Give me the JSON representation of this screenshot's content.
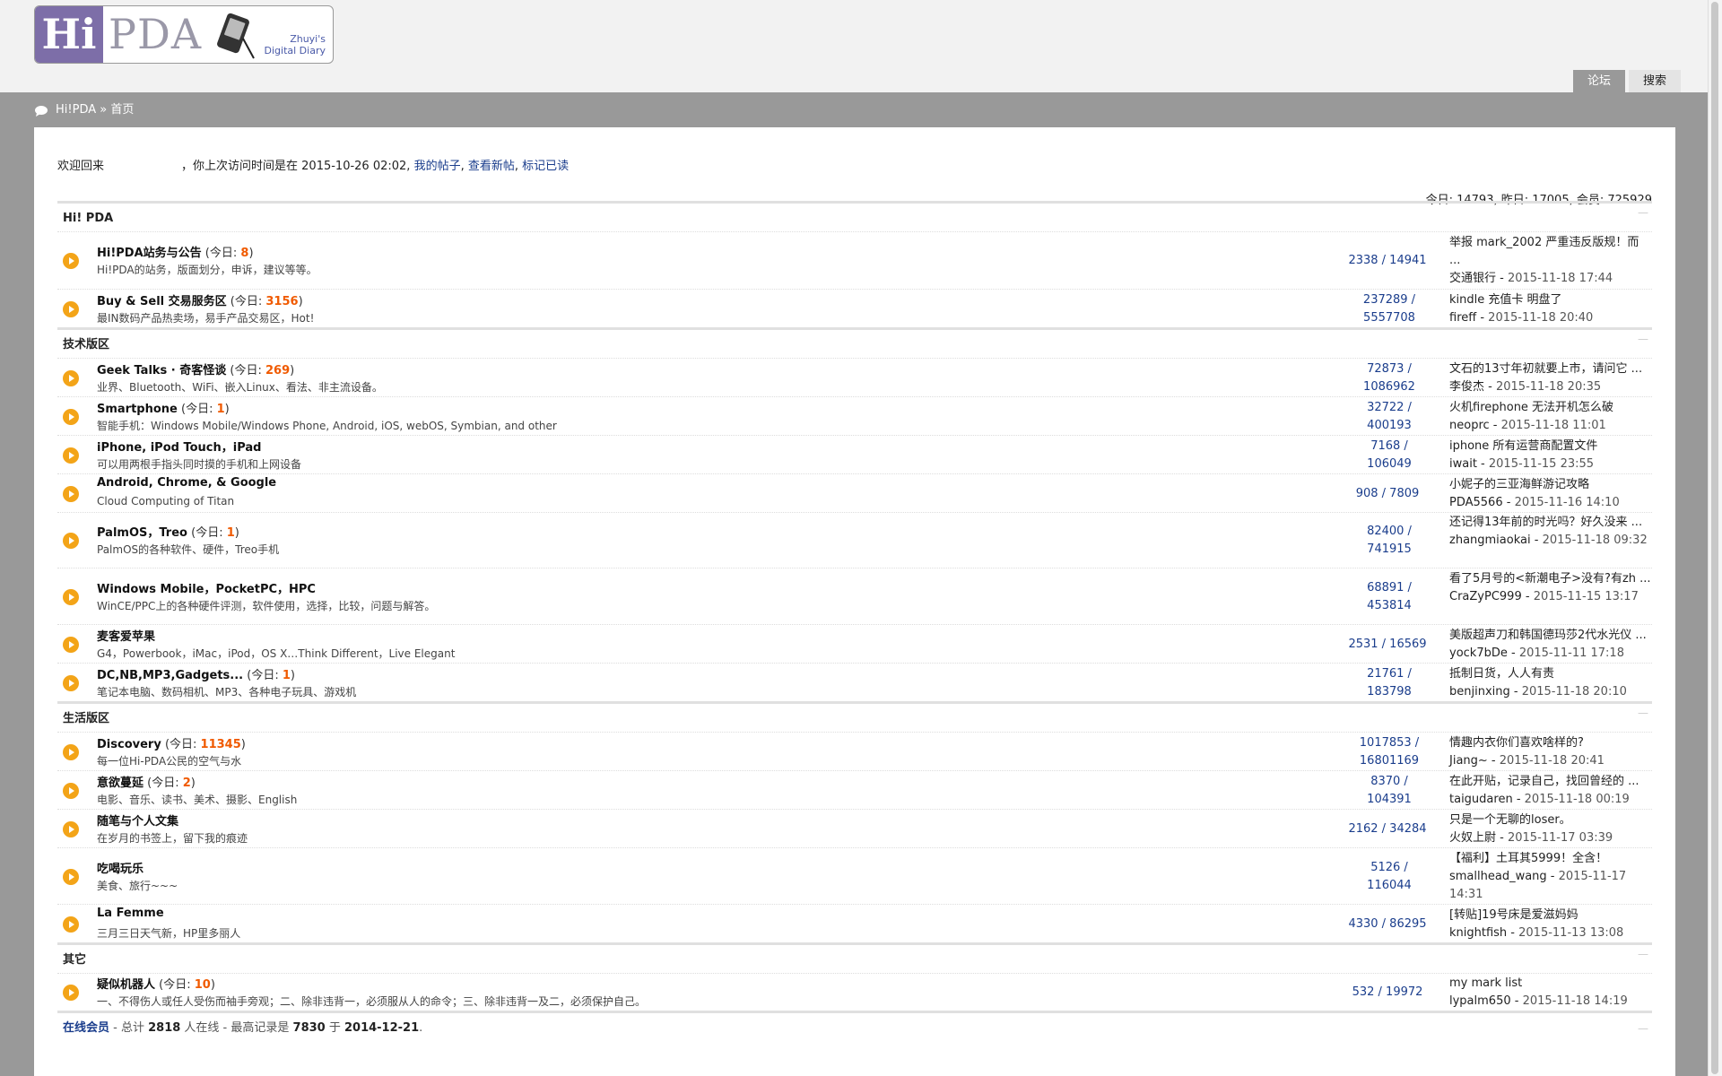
{
  "logo": {
    "hi": "Hi",
    "pda": "PDA",
    "tag_line1": "Zhuyi's",
    "tag_line2": "Digital Diary"
  },
  "nav": {
    "forum": "论坛",
    "search": "搜索"
  },
  "breadcrumb": {
    "site": "Hi!PDA",
    "sep": "»",
    "page": "首页"
  },
  "welcome": {
    "prefix": "欢迎回来",
    "last_visit": "，你上次访问时间是在 2015-10-26 02:02,",
    "my_posts": "我的帖子",
    "new_posts": "查看新帖",
    "mark_read": "标记已读",
    "comma": ","
  },
  "stats": "今日: 14793, 昨日: 17005, 会员: 725929",
  "today_label": "今日: ",
  "categories": [
    {
      "name": "Hi! PDA",
      "forums": [
        {
          "name": "Hi!PDA站务与公告",
          "today": "8",
          "desc": "Hi!PDA的站务，版面划分，申诉，建议等等。",
          "count": "2338 / 14941",
          "last_title": "举报 mark_2002 严重违反版规！而 ...",
          "last_user": "交通银行",
          "last_time": "2015-11-18 17:44"
        },
        {
          "name": "Buy & Sell 交易服务区",
          "today": "3156",
          "desc": "最IN数码产品热卖场，易手产品交易区，Hot!",
          "count": "237289 / 5557708",
          "last_title": "kindle 充值卡 明盘了",
          "last_user": "fireff",
          "last_time": "2015-11-18 20:40"
        }
      ]
    },
    {
      "name": "技术版区",
      "forums": [
        {
          "name": "Geek Talks · 奇客怪谈",
          "today": "269",
          "desc": "业界、Bluetooth、WiFi、嵌入Linux、看法、非主流设备。",
          "count": "72873 / 1086962",
          "last_title": "文石的13寸年初就要上市，请问它 ...",
          "last_user": "李俊杰",
          "last_time": "2015-11-18 20:35"
        },
        {
          "name": "Smartphone",
          "today": "1",
          "desc": "智能手机：Windows Mobile/Windows Phone, Android, iOS, webOS, Symbian, and other",
          "count": "32722 / 400193",
          "last_title": "火机firephone 无法开机怎么破",
          "last_user": "neoprc",
          "last_time": "2015-11-18 11:01"
        },
        {
          "name": "iPhone, iPod Touch，iPad",
          "today": "",
          "desc": "可以用两根手指头同时摸的手机和上网设备",
          "count": "7168 / 106049",
          "last_title": "iphone 所有运营商配置文件",
          "last_user": "iwait",
          "last_time": "2015-11-15 23:55"
        },
        {
          "name": "Android, Chrome, & Google",
          "today": "",
          "desc": "Cloud Computing of Titan",
          "count": "908 / 7809",
          "last_title": "小妮子的三亚海鲜游记攻略",
          "last_user": "PDA5566",
          "last_time": "2015-11-16 14:10"
        },
        {
          "name": "PalmOS，Treo",
          "today": "1",
          "desc": "PalmOS的各种软件、硬件，Treo手机",
          "count": "82400 / 741915",
          "last_title": "还记得13年前的时光吗？好久没来 ...",
          "last_user": "zhangmiaokai",
          "last_time": "2015-11-18 09:32"
        },
        {
          "name": "Windows Mobile，PocketPC，HPC",
          "today": "",
          "desc": "WinCE/PPC上的各种硬件评测，软件使用，选择，比较，问题与解答。",
          "count": "68891 / 453814",
          "last_title": "看了5月号的<新潮电子>没有?有zh ...",
          "last_user": "CraZyPC999",
          "last_time": "2015-11-15 13:17"
        },
        {
          "name": "麦客爱苹果",
          "today": "",
          "desc": "G4，Powerbook，iMac，iPod，OS X…Think Different，Live Elegant",
          "count": "2531 / 16569",
          "last_title": "美版超声刀和韩国德玛莎2代水光仪 ...",
          "last_user": "yock7bDe",
          "last_time": "2015-11-11 17:18"
        },
        {
          "name": "DC,NB,MP3,Gadgets...",
          "today": "1",
          "desc": "笔记本电脑、数码相机、MP3、各种电子玩具、游戏机",
          "count": "21761 / 183798",
          "last_title": "抵制日货，人人有责",
          "last_user": "benjinxing",
          "last_time": "2015-11-18 20:10"
        }
      ]
    },
    {
      "name": "生活版区",
      "forums": [
        {
          "name": "Discovery",
          "today": "11345",
          "desc": "每一位Hi-PDA公民的空气与水",
          "count": "1017853 / 16801169",
          "last_title": "情趣内衣你们喜欢啥样的?",
          "last_user": "Jiang~",
          "last_time": "2015-11-18 20:41"
        },
        {
          "name": "意欲蔓延",
          "today": "2",
          "desc": "电影、音乐、读书、美术、摄影、English",
          "count": "8370 / 104391",
          "last_title": "在此开贴，记录自己，找回曾经的 ...",
          "last_user": "taigudaren",
          "last_time": "2015-11-18 00:19"
        },
        {
          "name": "随笔与个人文集",
          "today": "",
          "desc": "在岁月的书签上，留下我的痕迹",
          "count": "2162 / 34284",
          "last_title": "只是一个无聊的loser。",
          "last_user": "火奴上尉",
          "last_time": "2015-11-17 03:39"
        },
        {
          "name": "吃喝玩乐",
          "today": "",
          "desc": "美食、旅行~~~",
          "count": "5126 / 116044",
          "last_title": "【福利】土耳其5999！全含！",
          "last_user": "smallhead_wang",
          "last_time": "2015-11-17 14:31"
        },
        {
          "name": "La Femme",
          "today": "",
          "desc": "三月三日天气新，HP里多丽人",
          "count": "4330 / 86295",
          "last_title": "[转贴]19号床是爱滋妈妈",
          "last_user": "knightfish",
          "last_time": "2015-11-13 13:08"
        }
      ]
    },
    {
      "name": "其它",
      "forums": [
        {
          "name": "疑似机器人",
          "today": "10",
          "desc": "一、不得伤人或任人受伤而袖手旁观；二、除非违背一，必须服从人的命令；三、除非违背一及二，必须保护自己。",
          "count": "532 / 19972",
          "last_title": "my mark list",
          "last_user": "lypalm650",
          "last_time": "2015-11-18 14:19"
        }
      ]
    }
  ],
  "online": {
    "label": "在线会员",
    "text1": " - 总计 ",
    "total": "2818",
    "text2": " 人在线 - 最高记录是 ",
    "max": "7830",
    "text3": " 于 ",
    "date": "2014-12-21",
    "text4": "."
  },
  "collapse_glyph": "—",
  "colors": {
    "accent": "#7d6ea8",
    "today_count": "#f05a00",
    "link": "#1a3d8c",
    "icon": "#f3a418"
  }
}
